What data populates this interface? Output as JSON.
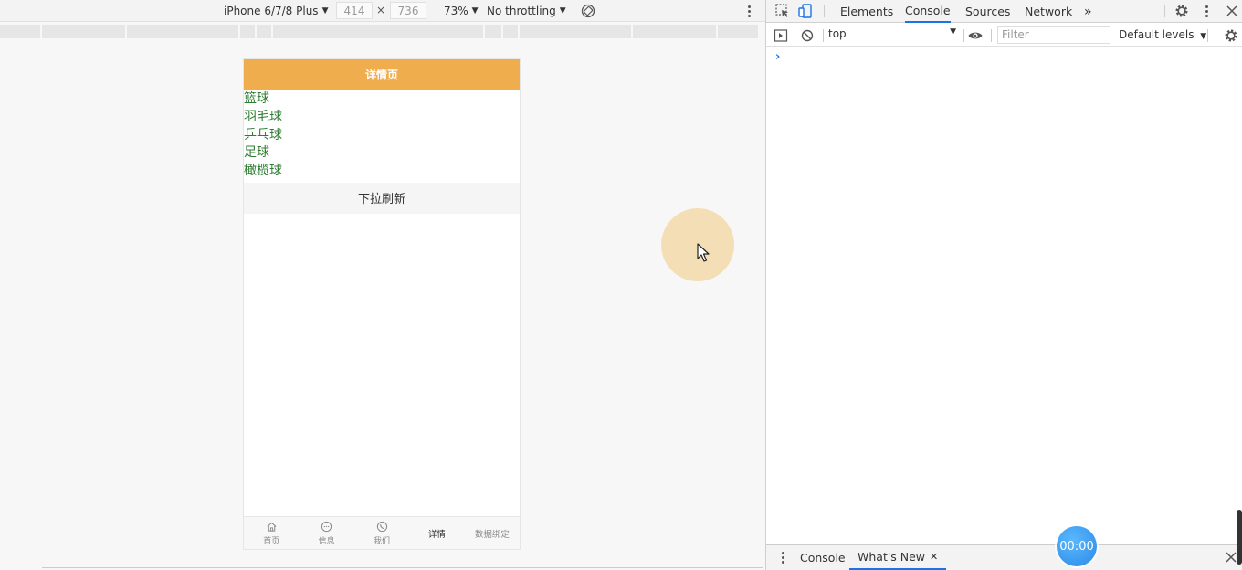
{
  "emulation": {
    "device": "iPhone 6/7/8 Plus",
    "width": "414",
    "height": "736",
    "dim_sep": "×",
    "zoom": "73%",
    "throttling": "No throttling"
  },
  "app": {
    "header_title": "详情页",
    "sports": [
      "篮球",
      "羽毛球",
      "乒乓球",
      "足球",
      "橄榄球"
    ],
    "pull_refresh": "下拉刷新",
    "tabs": [
      {
        "label": "首页",
        "icon": "home-icon"
      },
      {
        "label": "信息",
        "icon": "chat-icon"
      },
      {
        "label": "我们",
        "icon": "phone-icon"
      },
      {
        "label": "详情",
        "icon": ""
      },
      {
        "label": "数据绑定",
        "icon": ""
      }
    ],
    "active_tab": "详情"
  },
  "devtools": {
    "tabs": [
      "Elements",
      "Console",
      "Sources",
      "Network"
    ],
    "active_tab": "Console",
    "context": "top",
    "filter_placeholder": "Filter",
    "levels": "Default levels",
    "prompt": "›",
    "drawer_tabs": [
      "Console",
      "What's New"
    ],
    "active_drawer_tab": "What's New",
    "drawer_close": "✕"
  },
  "recorder": {
    "timer": "00:00"
  },
  "colors": {
    "header": "#f0ad4e",
    "list_text": "#2e7d32",
    "accent": "#1a73e8"
  }
}
